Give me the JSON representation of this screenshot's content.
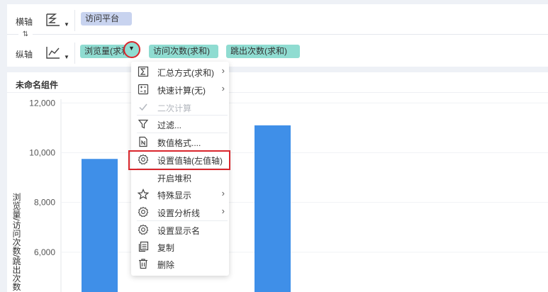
{
  "axis": {
    "x_label": "横轴",
    "y_label": "纵轴",
    "x_fields": [
      "访问平台"
    ],
    "y_fields": [
      "浏览量(求和)",
      "访问次数(求和)",
      "跳出次数(求和)"
    ]
  },
  "chart": {
    "title": "未命名组件",
    "y_axis_label": "浏览量/访问次数/跳出次数"
  },
  "colors": {
    "bar": "#3f8fe8",
    "measure_pill": "#8fdcd1",
    "dimension_pill": "#c8d3ef",
    "highlight": "#d9262c"
  },
  "menu": {
    "items": [
      {
        "label": "汇总方式(求和)",
        "icon": "sigma-icon",
        "submenu": true
      },
      {
        "label": "快速计算(无)",
        "icon": "calc-icon",
        "submenu": true
      },
      {
        "label": "二次计算",
        "icon": "check-icon",
        "disabled": true
      },
      {
        "label": "过滤...",
        "icon": "filter-icon"
      },
      {
        "label": "数值格式....",
        "icon": "number-format-icon"
      },
      {
        "label": "设置值轴(左值轴)",
        "icon": "gear-icon"
      },
      {
        "label": "开启堆积",
        "icon": ""
      },
      {
        "label": "特殊显示",
        "icon": "star-icon",
        "submenu": true
      },
      {
        "label": "设置分析线",
        "icon": "gear-icon",
        "submenu": true
      },
      {
        "label": "设置显示名",
        "icon": "gear-icon"
      },
      {
        "label": "复制",
        "icon": "copy-icon"
      },
      {
        "label": "删除",
        "icon": "trash-icon"
      }
    ]
  },
  "chart_data": {
    "type": "bar",
    "title": "未命名组件",
    "ylabel": "浏览量/访问次数/跳出次数",
    "yticks": [
      6000,
      8000,
      10000,
      12000
    ],
    "ytick_labels": [
      "6,000",
      "8,000",
      "10,000",
      "12,000"
    ],
    "ylim": [
      4400,
      12150
    ],
    "grid": true,
    "series": [
      {
        "values": [
          9750,
          11100
        ]
      }
    ]
  }
}
